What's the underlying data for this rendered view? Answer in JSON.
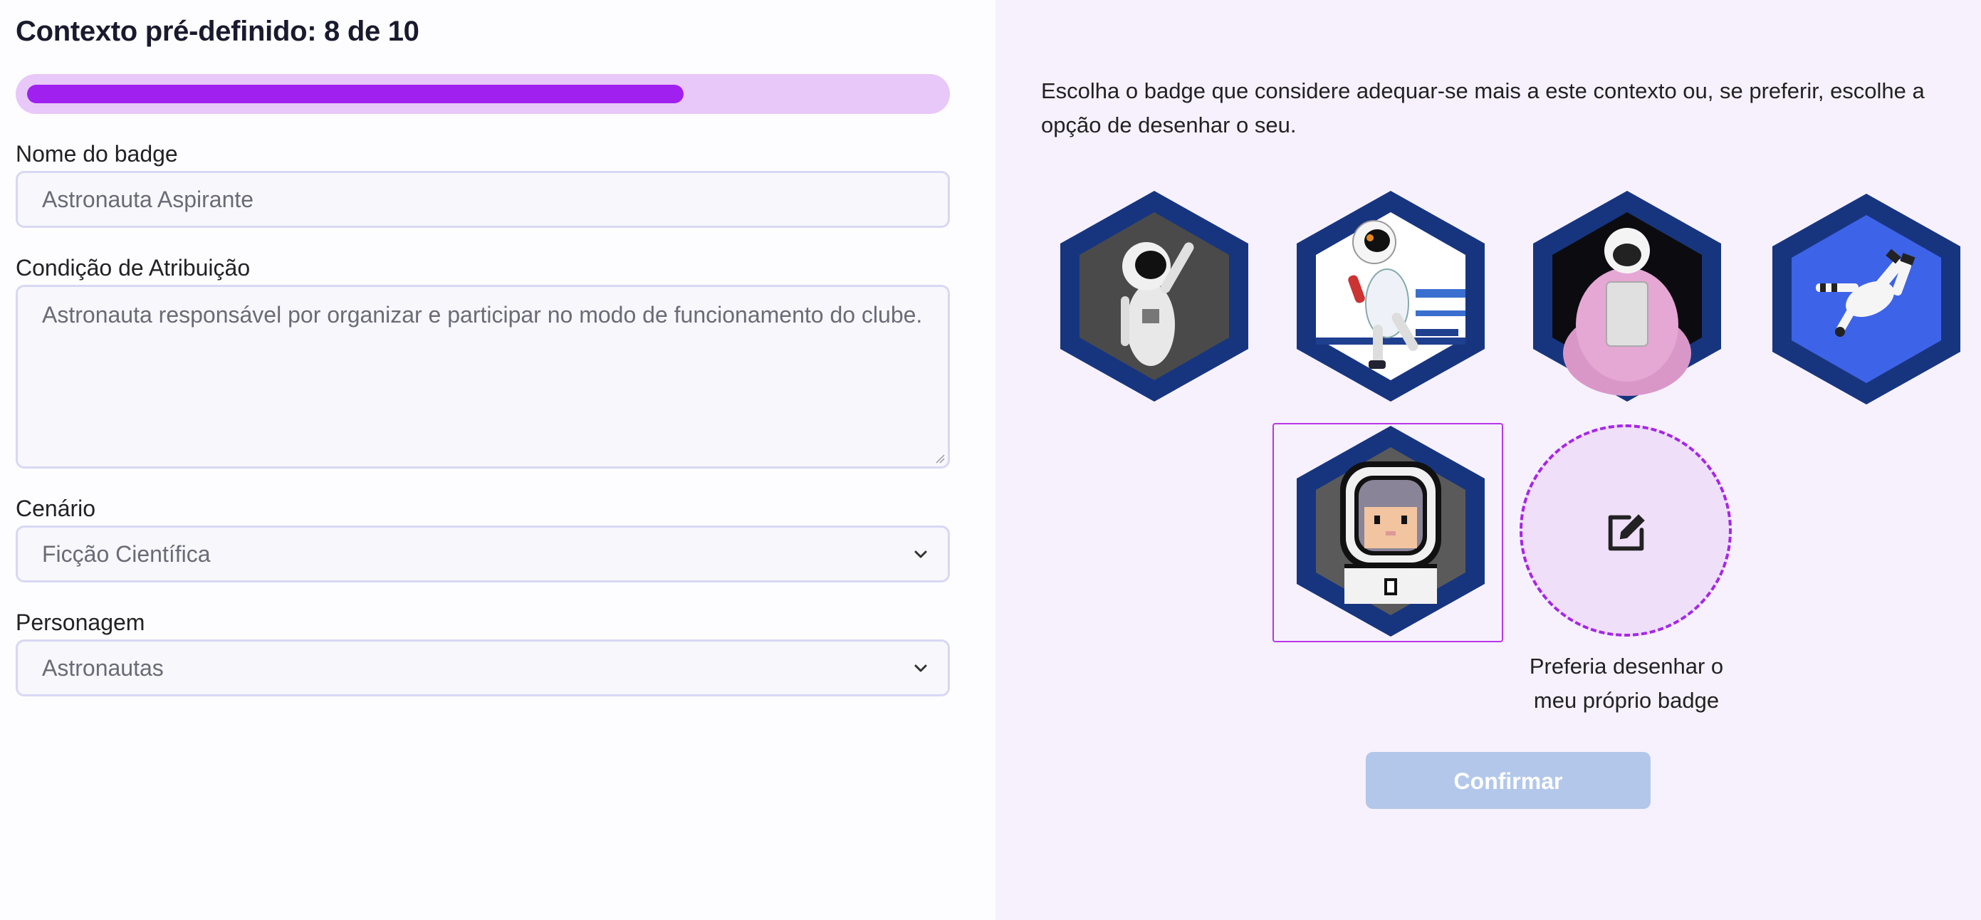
{
  "header": {
    "title": "Contexto pré-definido: 8 de 10"
  },
  "progress": {
    "current": 8,
    "total": 10,
    "fill_fraction": 0.72,
    "fill_color": "#a020f0",
    "track_color": "#e8c8f8"
  },
  "form": {
    "badge_name": {
      "label": "Nome do badge",
      "placeholder": "Astronauta Aspirante"
    },
    "condition": {
      "label": "Condição de Atribuição",
      "placeholder": "Astronauta responsável por organizar e participar no modo de funcionamento do clube."
    },
    "scenario": {
      "label": "Cenário",
      "value": "Ficção Científica"
    },
    "character": {
      "label": "Personagem",
      "value": "Astronautas"
    }
  },
  "badge_picker": {
    "instructions": "Escolha o badge que considere adequar-se mais a este contexto ou, se preferir, escolhe a opção de desenhar o seu.",
    "frame_color": "#17357f",
    "selected_index": 5,
    "badges": [
      {
        "icon": "astronaut-waving-badge-icon"
      },
      {
        "icon": "astronaut-floating-badge-icon"
      },
      {
        "icon": "astronaut-pink-suit-badge-icon"
      },
      {
        "icon": "astronaut-blue-badge-icon"
      },
      {
        "icon": "astronaut-pixel-badge-icon"
      }
    ],
    "draw_own": {
      "label": "Preferia desenhar o meu próprio badge",
      "icon": "edit-icon"
    }
  },
  "actions": {
    "confirm_label": "Confirmar",
    "confirm_color": "#b2c7ea"
  }
}
